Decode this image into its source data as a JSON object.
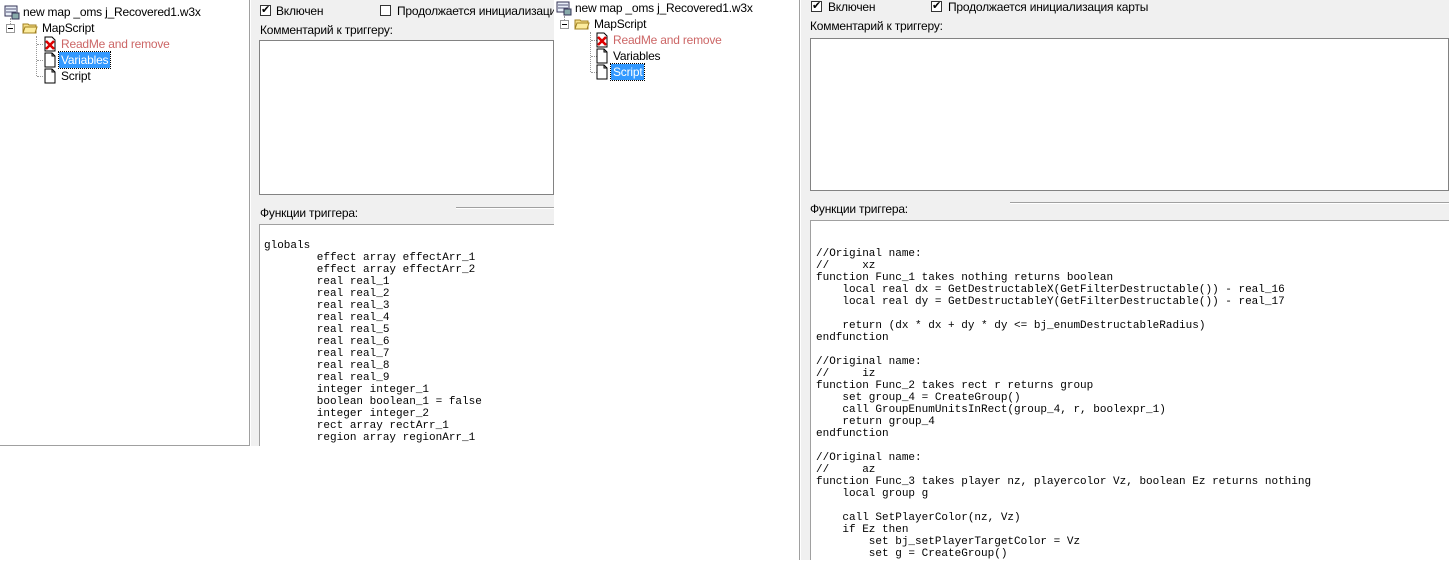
{
  "panel1": {
    "tree": {
      "root": "new map _oms j_Recovered1.w3x",
      "folder": "MapScript",
      "items": [
        {
          "label": "ReadMe and remove",
          "icon": "disabled-trigger-icon"
        },
        {
          "label": "Variables",
          "icon": "document-icon"
        },
        {
          "label": "Script",
          "icon": "document-icon"
        }
      ],
      "selected": "Variables"
    },
    "enabled_label": "Включен",
    "init_label": "Продолжается инициализация",
    "comment_label": "Комментарий к триггеру:",
    "functions_label": "Функции триггера:",
    "code": "globals\n        effect array effectArr_1\n        effect array effectArr_2\n        real real_1\n        real real_2\n        real real_3\n        real real_4\n        real real_5\n        real real_6\n        real real_7\n        real real_8\n        real real_9\n        integer integer_1\n        boolean boolean_1 = false\n        integer integer_2\n        rect array rectArr_1\n        region array regionArr_1"
  },
  "panel2": {
    "tree": {
      "root": "new map _oms j_Recovered1.w3x",
      "folder": "MapScript",
      "items": [
        {
          "label": "ReadMe and remove",
          "icon": "disabled-trigger-icon"
        },
        {
          "label": "Variables",
          "icon": "document-icon"
        },
        {
          "label": "Script",
          "icon": "document-icon"
        }
      ],
      "selected": "Script"
    },
    "enabled_label": "Включен",
    "init_label": "Продолжается инициализация карты",
    "comment_label": "Комментарий к триггеру:",
    "functions_label": "Функции триггера:",
    "code": "//Original name:\n//     xz\nfunction Func_1 takes nothing returns boolean\n    local real dx = GetDestructableX(GetFilterDestructable()) - real_16\n    local real dy = GetDestructableY(GetFilterDestructable()) - real_17\n\n    return (dx * dx + dy * dy <= bj_enumDestructableRadius)\nendfunction\n\n//Original name:\n//     iz\nfunction Func_2 takes rect r returns group\n    set group_4 = CreateGroup()\n    call GroupEnumUnitsInRect(group_4, r, boolexpr_1)\n    return group_4\nendfunction\n\n//Original name:\n//     az\nfunction Func_3 takes player nz, playercolor Vz, boolean Ez returns nothing\n    local group g\n\n    call SetPlayerColor(nz, Vz)\n    if Ez then\n        set bj_setPlayerTargetColor = Vz\n        set g = CreateGroup()"
  }
}
